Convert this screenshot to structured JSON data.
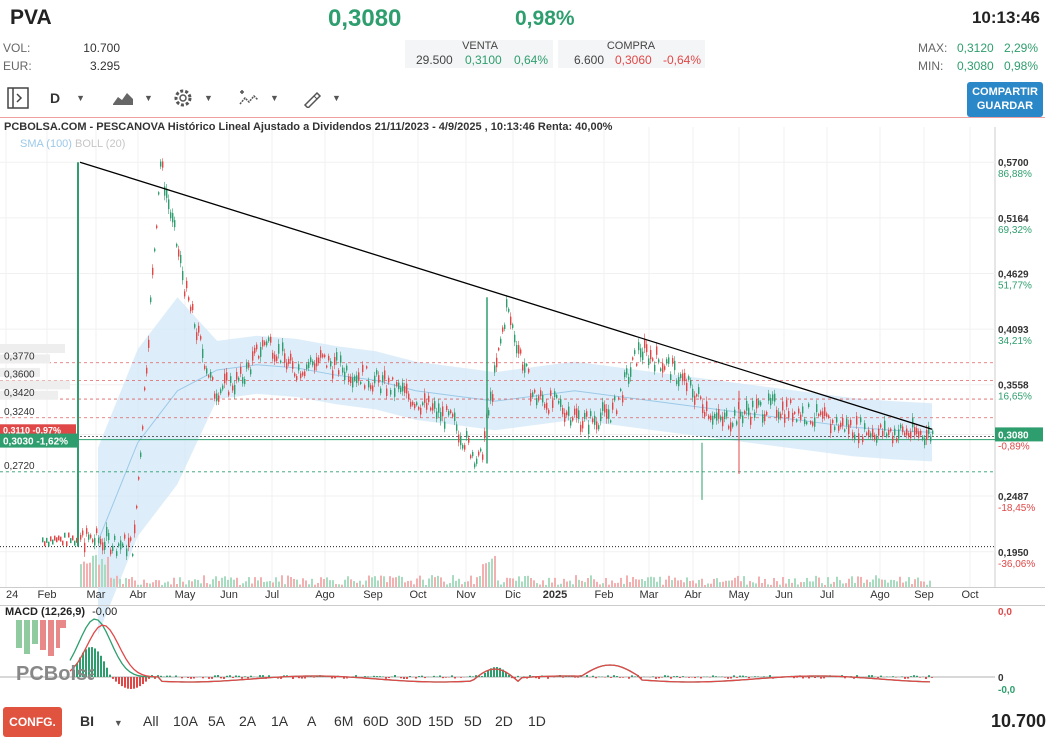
{
  "header": {
    "ticker": "PVA",
    "price": "0,3080",
    "change_pct": "0,98%",
    "time": "10:13:46"
  },
  "stats": {
    "vol_label": "VOL:",
    "vol_value": "10.700",
    "eur_label": "EUR:",
    "eur_value": "3.295",
    "max_label": "MAX:",
    "max_value": "0,3120",
    "max_pct": "2,29%",
    "min_label": "MIN:",
    "min_value": "0,3080",
    "min_pct": "0,98%"
  },
  "orderbook": {
    "venta_label": "VENTA",
    "venta_qty": "29.500",
    "venta_price": "0,3100",
    "venta_pct": "0,64%",
    "compra_label": "COMPRA",
    "compra_qty": "6.600",
    "compra_price": "0,3060",
    "compra_pct": "-0,64%"
  },
  "toolbar": {
    "interval": "D",
    "share_label": "COMPARTIR",
    "save_label": "GUARDAR"
  },
  "chart": {
    "title": "PCBOLSA.COM - PESCANOVA Histórico Lineal Ajustado a Dividendos 21/11/2023 - 4/9/2025 , 10:13:46 Renta: 40,00%",
    "legend_sma": "SMA (100)",
    "legend_boll": "BOLL (20)",
    "macd_label": "MACD (12,26,9)",
    "macd_value": "-0,00",
    "watermark": "PCBolsa",
    "last_price_label": "0,3080",
    "left_level_label": "0,3030 -1,62%",
    "left_level_label2": "0,3110 -0,97%"
  },
  "chart_data": {
    "type": "line",
    "x_tick_labels": [
      "24",
      "Feb",
      "Mar",
      "Abr",
      "May",
      "Jun",
      "Jul",
      "Ago",
      "Sep",
      "Oct",
      "Nov",
      "Dic",
      "2025",
      "Feb",
      "Mar",
      "Abr",
      "May",
      "Jun",
      "Jul",
      "Ago",
      "Sep",
      "Oct"
    ],
    "right_axis": [
      {
        "price": "0,5700",
        "pct": "86,88%"
      },
      {
        "price": "0,5164",
        "pct": "69,32%"
      },
      {
        "price": "0,4629",
        "pct": "51,77%"
      },
      {
        "price": "0,4093",
        "pct": "34,21%"
      },
      {
        "price": "0,3558",
        "pct": "16,65%"
      },
      {
        "price": "0,3080",
        "pct": "-0,89%"
      },
      {
        "price": "0,2487",
        "pct": "-18,45%"
      },
      {
        "price": "0,1950",
        "pct": "-36,06%"
      }
    ],
    "left_levels": [
      "0,3770",
      "0,3600",
      "0,3420",
      "0,3240",
      "0,2720"
    ],
    "ylim": [
      0.19,
      0.575
    ],
    "macd_right_axis": [
      "0,0",
      "0",
      "-0,0"
    ],
    "series": [
      {
        "name": "PVA",
        "y_points": [
          0.208,
          0.205,
          0.2,
          0.57,
          0.44,
          0.35,
          0.36,
          0.4,
          0.37,
          0.38,
          0.37,
          0.36,
          0.35,
          0.335,
          0.32,
          0.28,
          0.43,
          0.345,
          0.335,
          0.32,
          0.33,
          0.39,
          0.375,
          0.35,
          0.32,
          0.33,
          0.335,
          0.33,
          0.32,
          0.315,
          0.31,
          0.31,
          0.308
        ]
      },
      {
        "name": "SMA (100)",
        "y_points": [
          0.205,
          0.3,
          0.35,
          0.37,
          0.375,
          0.372,
          0.365,
          0.36,
          0.35,
          0.345,
          0.34,
          0.345,
          0.35,
          0.345,
          0.34,
          0.335,
          0.33,
          0.325,
          0.32,
          0.315,
          0.312,
          0.31
        ]
      }
    ],
    "annotations": [
      "descending trendline from 0,5700 to 0,3120",
      "support line 0,3030"
    ],
    "colors": {
      "up": "#2e9e6e",
      "down": "#e04848",
      "band": "#cfe7f8",
      "trend": "#000000"
    },
    "grid": true
  }
}
